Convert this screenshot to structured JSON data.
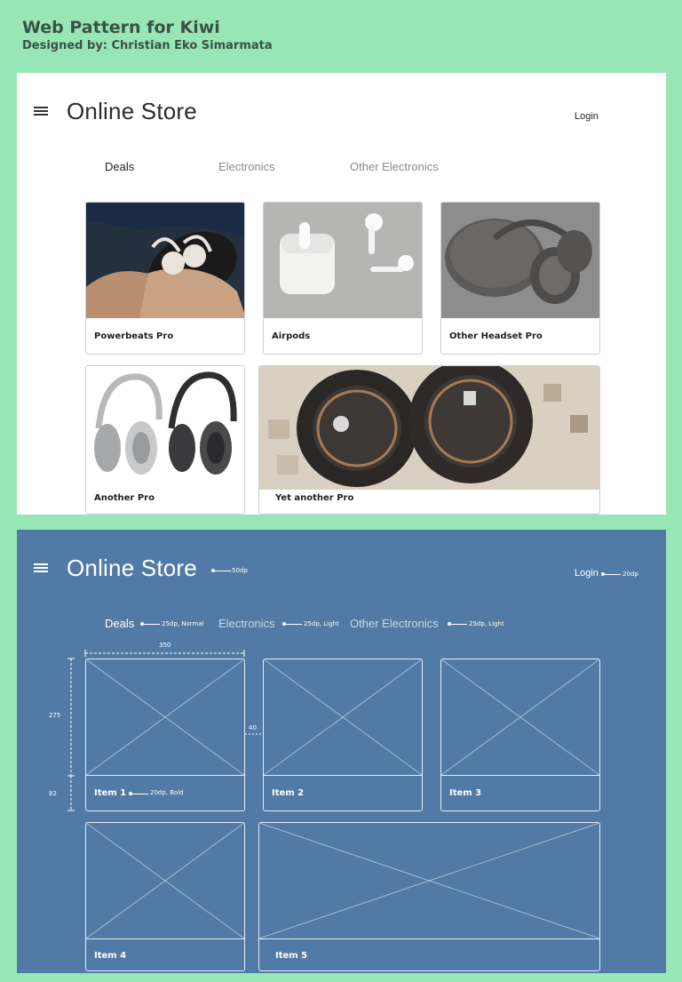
{
  "header": {
    "title": "Web Pattern for Kiwi",
    "subtitle": "Designed by: Christian Eko Simarmata"
  },
  "store": {
    "title": "Online Store",
    "login": "Login",
    "tabs": [
      {
        "label": "Deals",
        "active": true
      },
      {
        "label": "Electronics",
        "active": false
      },
      {
        "label": "Other Electronics",
        "active": false
      }
    ]
  },
  "products": [
    {
      "label": "Powerbeats Pro",
      "image": "earbuds-case-photo"
    },
    {
      "label": "Airpods",
      "image": "airpods-photo"
    },
    {
      "label": "Other Headset Pro",
      "image": "headset-case-photo"
    },
    {
      "label": "Another Pro",
      "image": "two-headphones-photo"
    },
    {
      "label": "Yet another Pro",
      "image": "headphones-closeup-photo"
    }
  ],
  "wireframe": {
    "items": [
      "Item 1",
      "Item 2",
      "Item 3",
      "Item 4",
      "Item 5"
    ],
    "annotations": {
      "title_size": "50dp",
      "login_size": "20dp",
      "tab_active": "25dp, Normal",
      "tab_light_1": "25dp, Light",
      "tab_light_2": "25dp, Light",
      "item_label": "20dp, Bold",
      "card_width": "350",
      "gap": "40",
      "image_height": "275",
      "label_height": "82"
    }
  },
  "colors": {
    "background": "#98e6b5",
    "wireframe_panel": "#517ba6",
    "header_text": "#3a5147"
  }
}
